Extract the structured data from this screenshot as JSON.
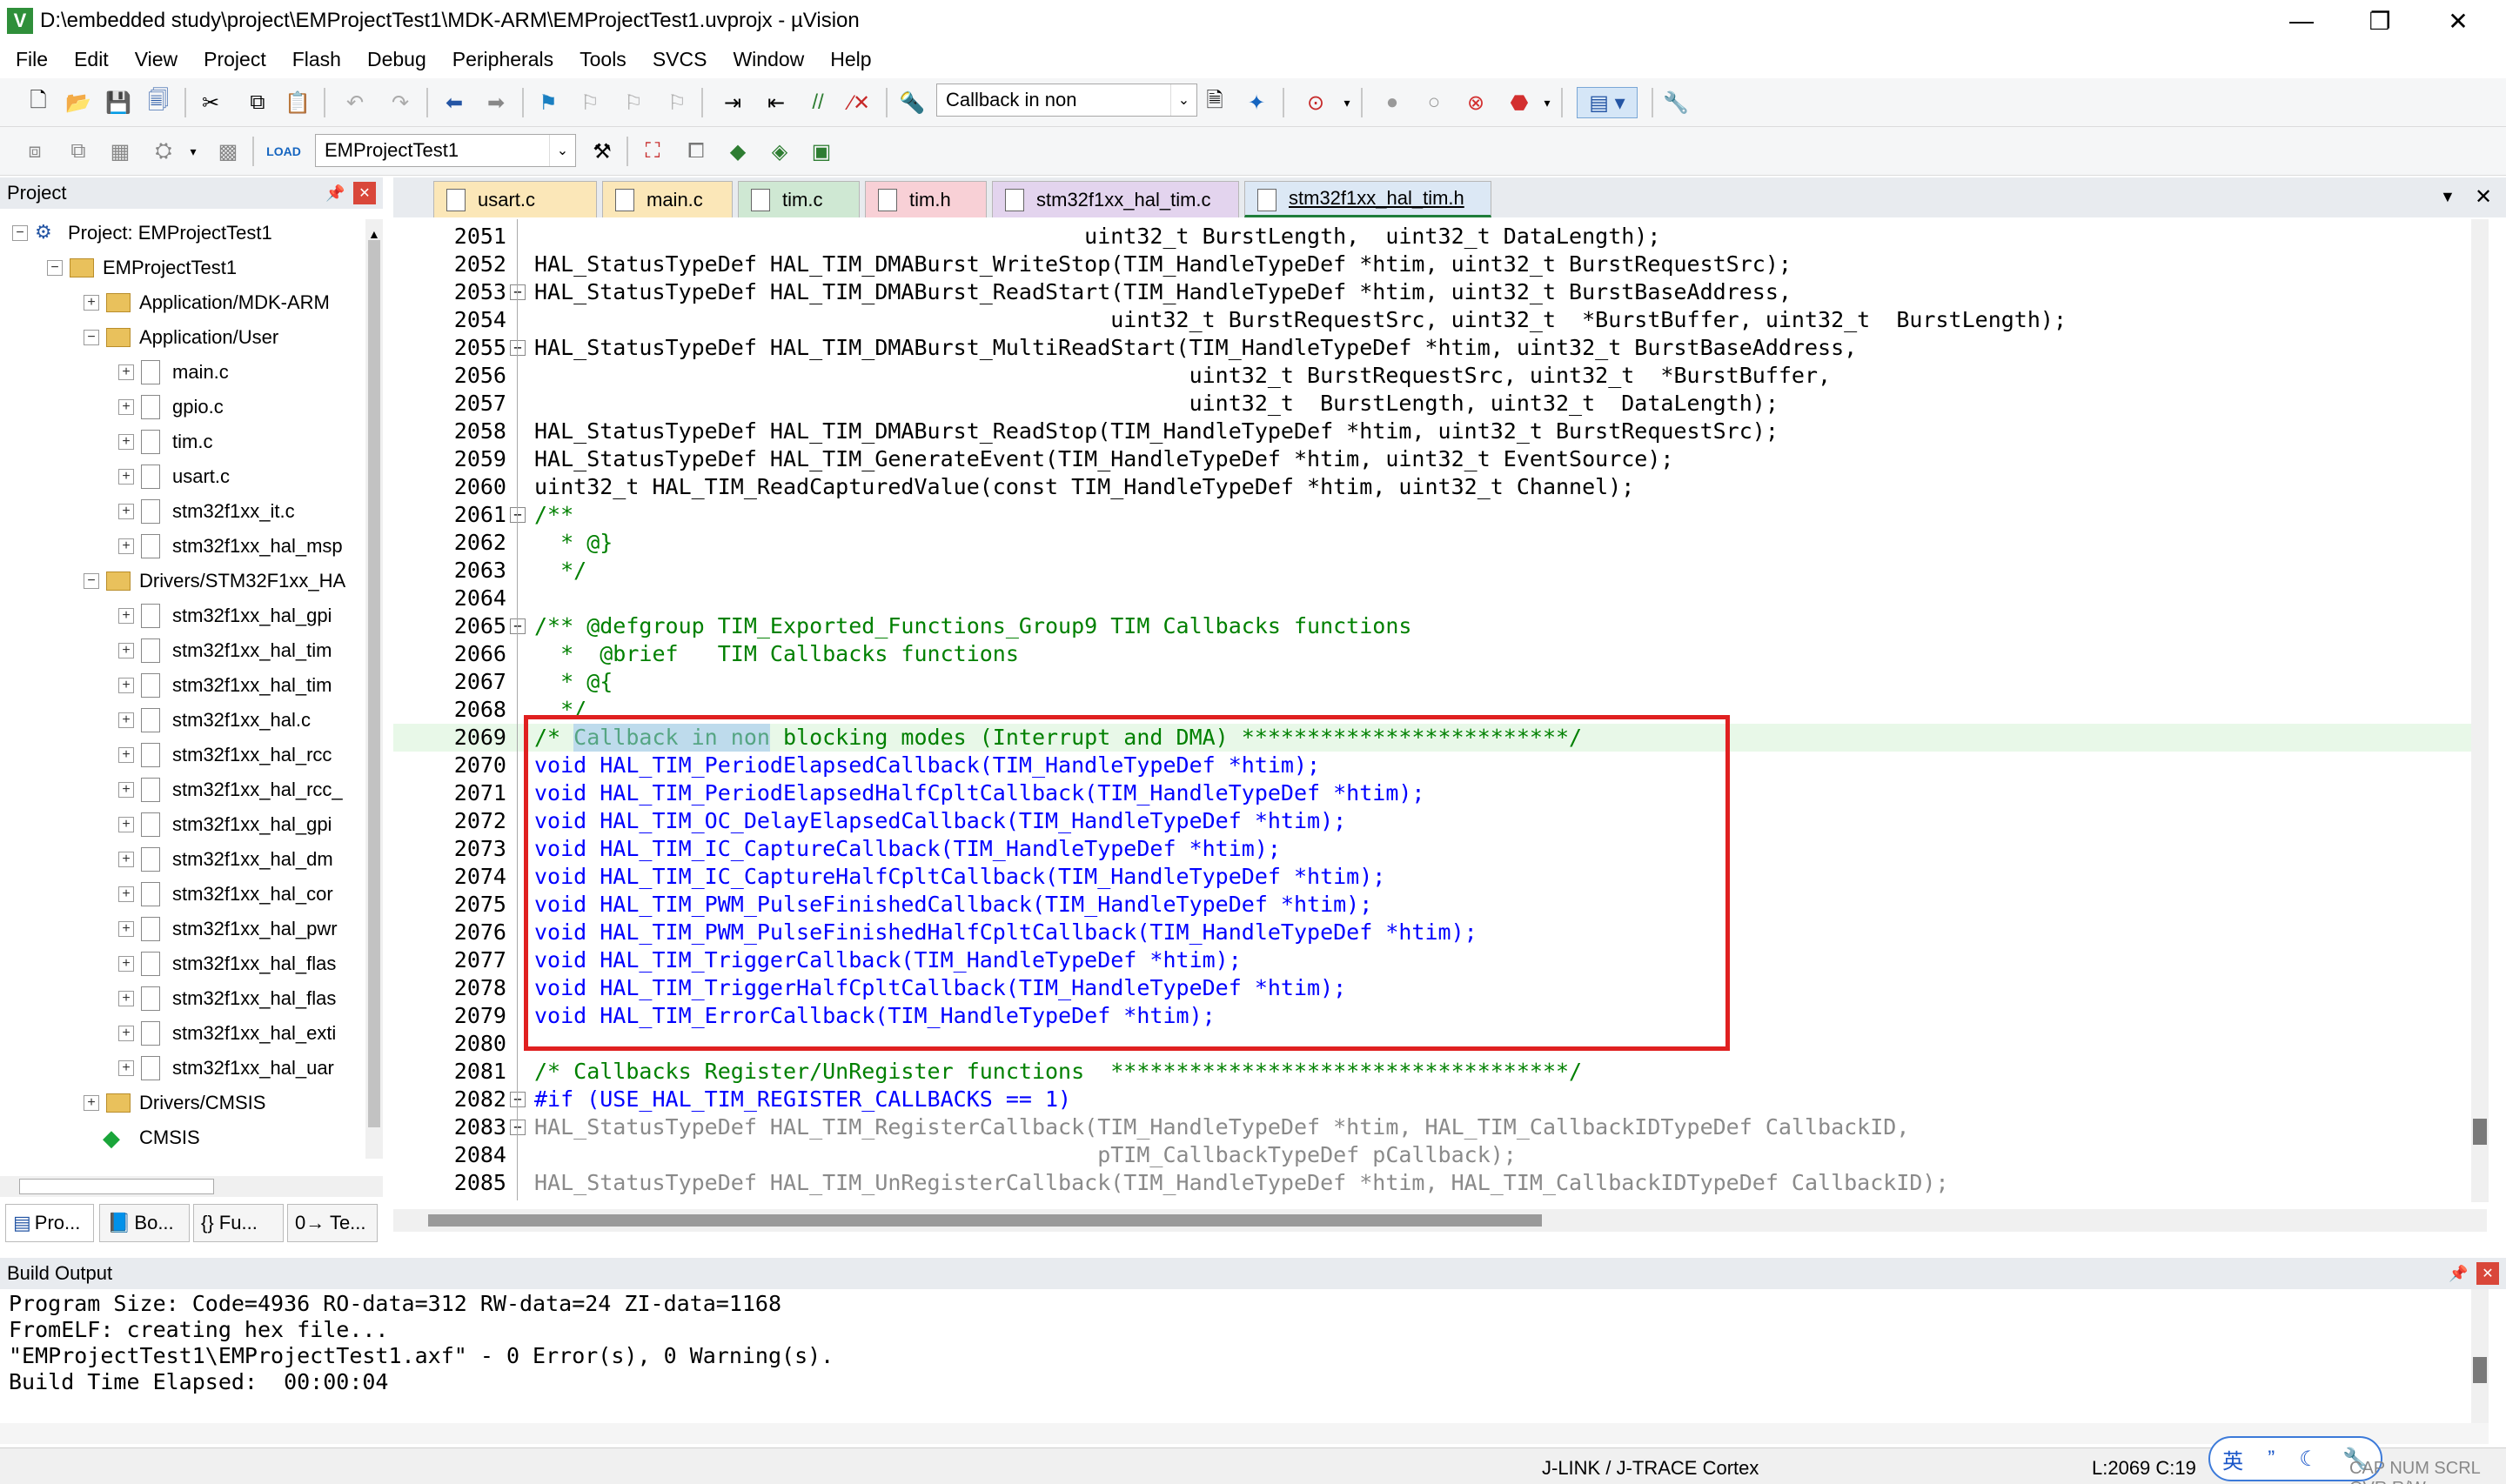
{
  "window": {
    "title": "D:\\embedded study\\project\\EMProjectTest1\\MDK-ARM\\EMProjectTest1.uvprojx - µVision",
    "minimize": "—",
    "restore": "❐",
    "close": "✕"
  },
  "menu": [
    "File",
    "Edit",
    "View",
    "Project",
    "Flash",
    "Debug",
    "Peripherals",
    "Tools",
    "SVCS",
    "Window",
    "Help"
  ],
  "toolbar": {
    "find_combo": "Callback in non",
    "target_combo": "EMProjectTest1"
  },
  "project_panel": {
    "title": "Project",
    "pin": "📌",
    "close": "✕",
    "items": [
      {
        "label": "Project: EMProjectTest1",
        "exp": "−"
      },
      {
        "label": "EMProjectTest1",
        "exp": "−"
      },
      {
        "label": "Application/MDK-ARM",
        "exp": "+"
      },
      {
        "label": "Application/User",
        "exp": "−"
      },
      {
        "label": "main.c",
        "exp": "+"
      },
      {
        "label": "gpio.c",
        "exp": "+"
      },
      {
        "label": "tim.c",
        "exp": "+"
      },
      {
        "label": "usart.c",
        "exp": "+"
      },
      {
        "label": "stm32f1xx_it.c",
        "exp": "+"
      },
      {
        "label": "stm32f1xx_hal_msp",
        "exp": "+"
      },
      {
        "label": "Drivers/STM32F1xx_HA",
        "exp": "−"
      },
      {
        "label": "stm32f1xx_hal_gpi",
        "exp": "+"
      },
      {
        "label": "stm32f1xx_hal_tim",
        "exp": "+"
      },
      {
        "label": "stm32f1xx_hal_tim",
        "exp": "+"
      },
      {
        "label": "stm32f1xx_hal.c",
        "exp": "+"
      },
      {
        "label": "stm32f1xx_hal_rcc",
        "exp": "+"
      },
      {
        "label": "stm32f1xx_hal_rcc_",
        "exp": "+"
      },
      {
        "label": "stm32f1xx_hal_gpi",
        "exp": "+"
      },
      {
        "label": "stm32f1xx_hal_dm",
        "exp": "+"
      },
      {
        "label": "stm32f1xx_hal_cor",
        "exp": "+"
      },
      {
        "label": "stm32f1xx_hal_pwr",
        "exp": "+"
      },
      {
        "label": "stm32f1xx_hal_flas",
        "exp": "+"
      },
      {
        "label": "stm32f1xx_hal_flas",
        "exp": "+"
      },
      {
        "label": "stm32f1xx_hal_exti",
        "exp": "+"
      },
      {
        "label": "stm32f1xx_hal_uar",
        "exp": "+"
      },
      {
        "label": "Drivers/CMSIS",
        "exp": "+"
      },
      {
        "label": "CMSIS",
        "exp": ""
      }
    ],
    "bottom_tabs": [
      "Pro...",
      "Bo...",
      "{} Fu...",
      "0→ Te..."
    ]
  },
  "tabs": [
    {
      "label": "usart.c"
    },
    {
      "label": "main.c"
    },
    {
      "label": "tim.c"
    },
    {
      "label": "tim.h"
    },
    {
      "label": "stm32f1xx_hal_tim.c"
    },
    {
      "label": "stm32f1xx_hal_tim.h"
    }
  ],
  "code_lines": [
    {
      "n": "2051",
      "t": "                                          uint32_t BurstLength,  uint32_t DataLength);"
    },
    {
      "n": "2052",
      "t": "HAL_StatusTypeDef HAL_TIM_DMABurst_WriteStop(TIM_HandleTypeDef *htim, uint32_t BurstRequestSrc);"
    },
    {
      "n": "2053",
      "t": "HAL_StatusTypeDef HAL_TIM_DMABurst_ReadStart(TIM_HandleTypeDef *htim, uint32_t BurstBaseAddress,"
    },
    {
      "n": "2054",
      "t": "                                            uint32_t BurstRequestSrc, uint32_t  *BurstBuffer, uint32_t  BurstLength);"
    },
    {
      "n": "2055",
      "t": "HAL_StatusTypeDef HAL_TIM_DMABurst_MultiReadStart(TIM_HandleTypeDef *htim, uint32_t BurstBaseAddress,"
    },
    {
      "n": "2056",
      "t": "                                                  uint32_t BurstRequestSrc, uint32_t  *BurstBuffer,"
    },
    {
      "n": "2057",
      "t": "                                                  uint32_t  BurstLength, uint32_t  DataLength);"
    },
    {
      "n": "2058",
      "t": "HAL_StatusTypeDef HAL_TIM_DMABurst_ReadStop(TIM_HandleTypeDef *htim, uint32_t BurstRequestSrc);"
    },
    {
      "n": "2059",
      "t": "HAL_StatusTypeDef HAL_TIM_GenerateEvent(TIM_HandleTypeDef *htim, uint32_t EventSource);"
    },
    {
      "n": "2060",
      "t": "uint32_t HAL_TIM_ReadCapturedValue(const TIM_HandleTypeDef *htim, uint32_t Channel);"
    },
    {
      "n": "2061",
      "t": "/**"
    },
    {
      "n": "2062",
      "t": "  * @}"
    },
    {
      "n": "2063",
      "t": "  */"
    },
    {
      "n": "2064",
      "t": ""
    },
    {
      "n": "2065",
      "t": "/** @defgroup TIM_Exported_Functions_Group9 TIM Callbacks functions"
    },
    {
      "n": "2066",
      "t": "  *  @brief   TIM Callbacks functions"
    },
    {
      "n": "2067",
      "t": "  * @{"
    },
    {
      "n": "2068",
      "t": "  */"
    },
    {
      "n": "2069",
      "t": "/* Callback in non blocking modes (Interrupt and DMA) *************************/"
    },
    {
      "n": "2070",
      "t": "void HAL_TIM_PeriodElapsedCallback(TIM_HandleTypeDef *htim);"
    },
    {
      "n": "2071",
      "t": "void HAL_TIM_PeriodElapsedHalfCpltCallback(TIM_HandleTypeDef *htim);"
    },
    {
      "n": "2072",
      "t": "void HAL_TIM_OC_DelayElapsedCallback(TIM_HandleTypeDef *htim);"
    },
    {
      "n": "2073",
      "t": "void HAL_TIM_IC_CaptureCallback(TIM_HandleTypeDef *htim);"
    },
    {
      "n": "2074",
      "t": "void HAL_TIM_IC_CaptureHalfCpltCallback(TIM_HandleTypeDef *htim);"
    },
    {
      "n": "2075",
      "t": "void HAL_TIM_PWM_PulseFinishedCallback(TIM_HandleTypeDef *htim);"
    },
    {
      "n": "2076",
      "t": "void HAL_TIM_PWM_PulseFinishedHalfCpltCallback(TIM_HandleTypeDef *htim);"
    },
    {
      "n": "2077",
      "t": "void HAL_TIM_TriggerCallback(TIM_HandleTypeDef *htim);"
    },
    {
      "n": "2078",
      "t": "void HAL_TIM_TriggerHalfCpltCallback(TIM_HandleTypeDef *htim);"
    },
    {
      "n": "2079",
      "t": "void HAL_TIM_ErrorCallback(TIM_HandleTypeDef *htim);"
    },
    {
      "n": "2080",
      "t": ""
    },
    {
      "n": "2081",
      "t": "/* Callbacks Register/UnRegister functions  ***********************************/"
    },
    {
      "n": "2082",
      "t": "#if (USE_HAL_TIM_REGISTER_CALLBACKS == 1)"
    },
    {
      "n": "2083",
      "t": "HAL_StatusTypeDef HAL_TIM_RegisterCallback(TIM_HandleTypeDef *htim, HAL_TIM_CallbackIDTypeDef CallbackID,"
    },
    {
      "n": "2084",
      "t": "                                           pTIM_CallbackTypeDef pCallback);"
    },
    {
      "n": "2085",
      "t": "HAL_StatusTypeDef HAL_TIM_UnRegisterCallback(TIM_HandleTypeDef *htim, HAL_TIM_CallbackIDTypeDef CallbackID);"
    }
  ],
  "build_output": {
    "title": "Build Output",
    "lines": [
      "Program Size: Code=4936 RO-data=312 RW-data=24 ZI-data=1168",
      "FromELF: creating hex file...",
      "\"EMProjectTest1\\EMProjectTest1.axf\" - 0 Error(s), 0 Warning(s).",
      "Build Time Elapsed:  00:00:04"
    ]
  },
  "status": {
    "debugger": "J-LINK / J-TRACE Cortex",
    "position": "L:2069 C:19",
    "ime": "英",
    "flags": "CAP NUM SCRL OVR R/W"
  },
  "colors": {
    "highlight_box": "#e02020",
    "keyword": "#0000ff",
    "comment": "#008000",
    "selection": "#cce4f7"
  }
}
